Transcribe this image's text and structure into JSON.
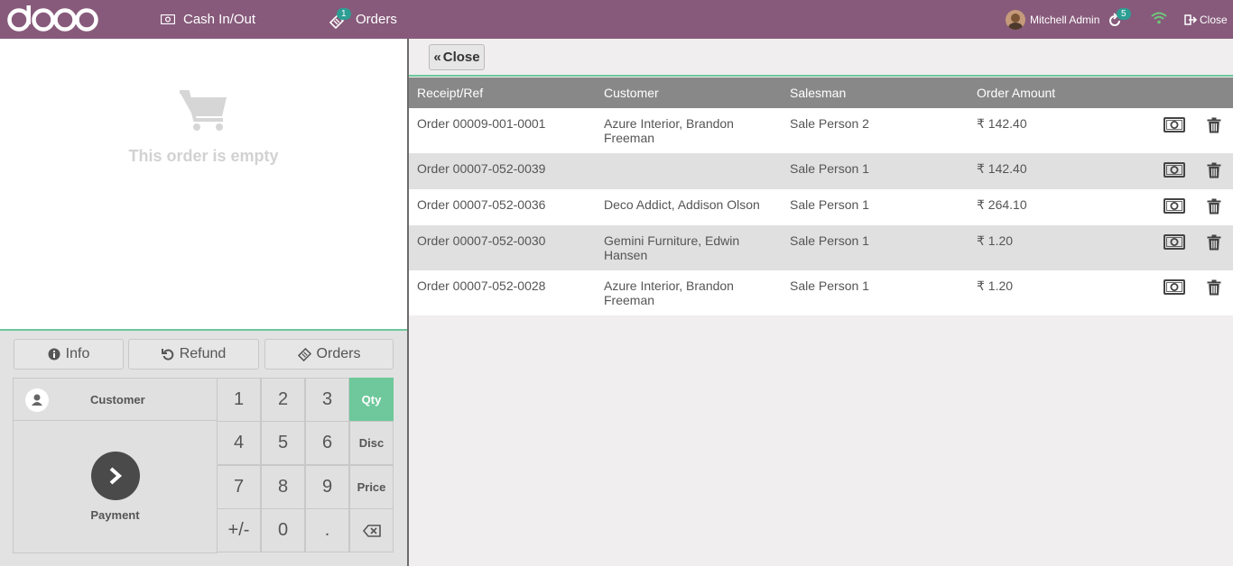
{
  "topbar": {
    "cash_label": "Cash In/Out",
    "orders_label": "Orders",
    "orders_badge": "1",
    "user_name": "Mitchell Admin",
    "sync_badge": "5",
    "close_label": "Close",
    "brand_color": "#875a7b"
  },
  "order": {
    "empty_message": "This order is empty"
  },
  "control_buttons": {
    "info": "Info",
    "refund": "Refund",
    "orders": "Orders"
  },
  "actionpad": {
    "customer": "Customer",
    "payment": "Payment"
  },
  "numpad": {
    "keys": [
      "1",
      "2",
      "3",
      "4",
      "5",
      "6",
      "7",
      "8",
      "9",
      "+/-",
      "0",
      "."
    ],
    "modes": [
      "Qty",
      "Disc",
      "Price"
    ],
    "active_mode": "Qty"
  },
  "ticket_screen": {
    "close_label": "Close",
    "columns": [
      "Receipt/Ref",
      "Customer",
      "Salesman",
      "Order Amount"
    ],
    "rows": [
      {
        "ref": "Order 00009-001-0001",
        "customer": "Azure Interior, Brandon Freeman",
        "salesman": "Sale Person 2",
        "amount": "₹ 142.40"
      },
      {
        "ref": "Order 00007-052-0039",
        "customer": "",
        "salesman": "Sale Person 1",
        "amount": "₹ 142.40"
      },
      {
        "ref": "Order 00007-052-0036",
        "customer": "Deco Addict, Addison Olson",
        "salesman": "Sale Person 1",
        "amount": "₹ 264.10"
      },
      {
        "ref": "Order 00007-052-0030",
        "customer": "Gemini Furniture, Edwin Hansen",
        "salesman": "Sale Person 1",
        "amount": "₹ 1.20"
      },
      {
        "ref": "Order 00007-052-0028",
        "customer": "Azure Interior, Brandon Freeman",
        "salesman": "Sale Person 1",
        "amount": "₹ 1.20"
      }
    ]
  },
  "colors": {
    "accent": "#6ec89b",
    "header_gray": "#888888",
    "row_alt": "#e0e0e0"
  }
}
